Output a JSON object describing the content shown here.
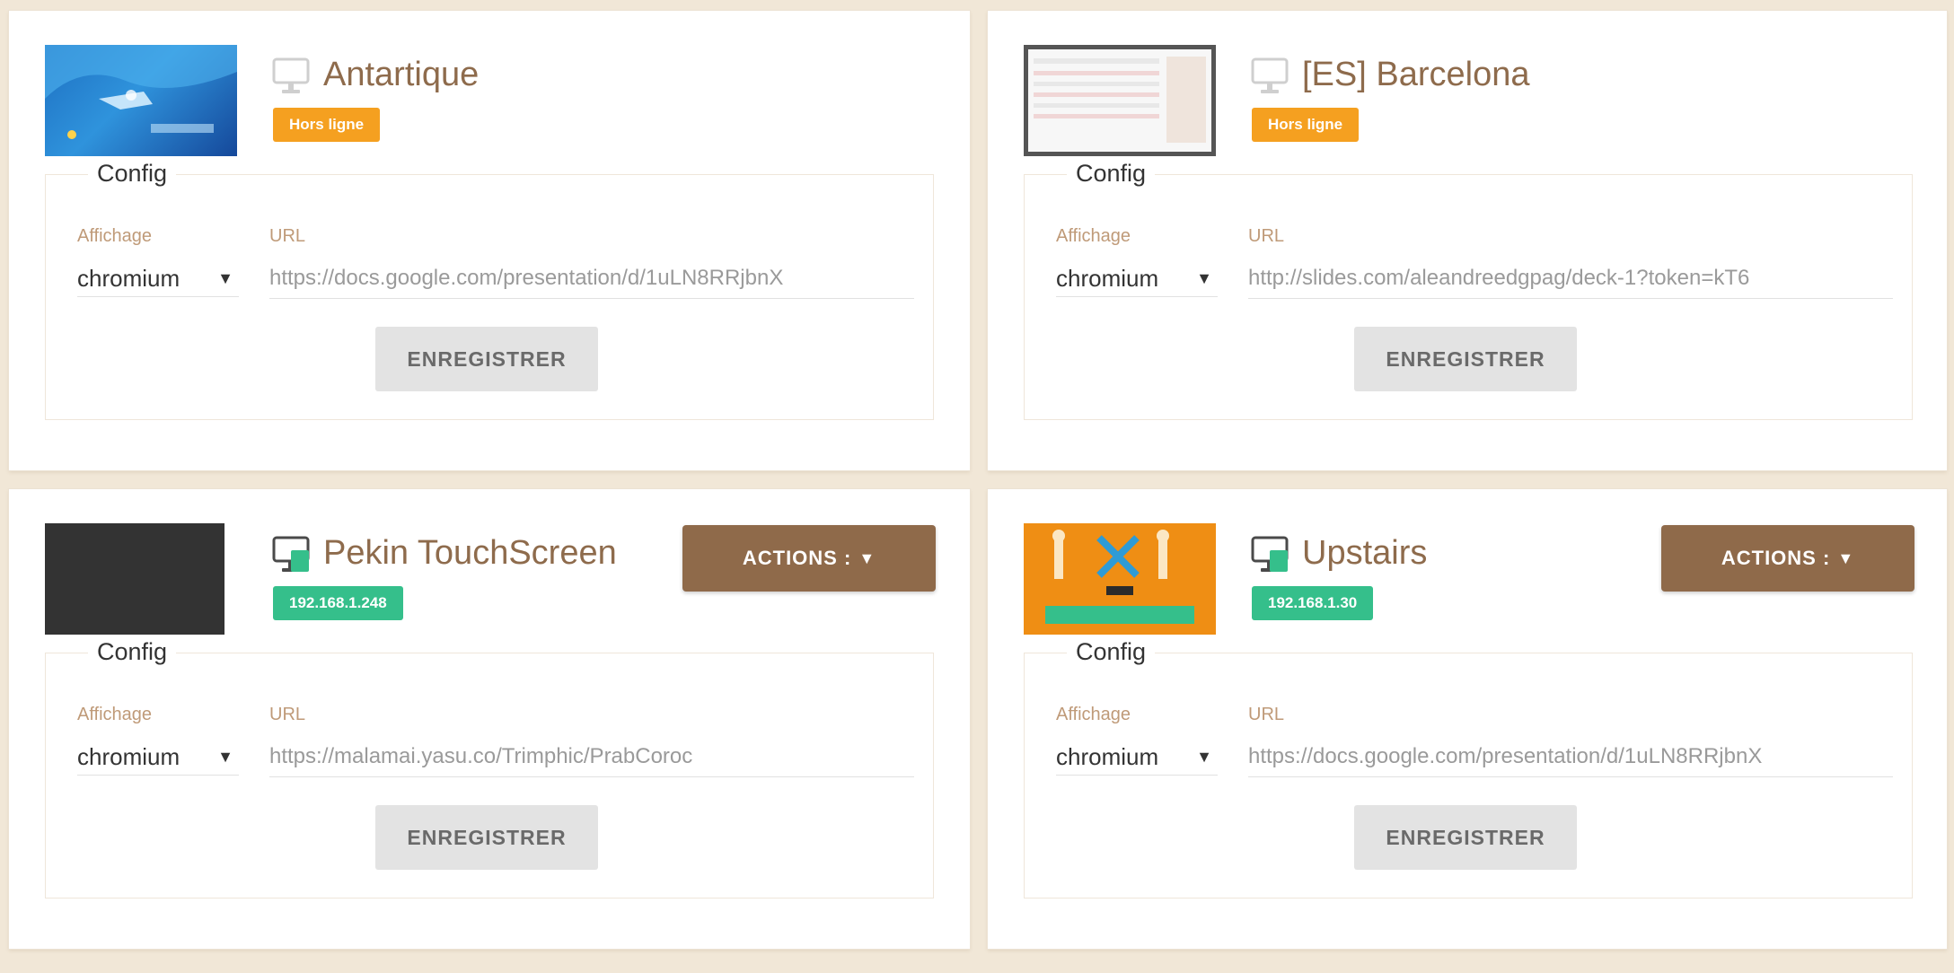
{
  "devices": [
    {
      "name": "Antartique",
      "status_badge": "Hors ligne",
      "config_legend": "Config",
      "affichage_label": "Affichage",
      "url_label": "URL",
      "affichage_value": "chromium",
      "url_value": "https://docs.google.com/presentation/d/1uLN8RRjbnX",
      "save_label": "ENREGISTRER"
    },
    {
      "name": "[ES] Barcelona",
      "status_badge": "Hors ligne",
      "config_legend": "Config",
      "affichage_label": "Affichage",
      "url_label": "URL",
      "affichage_value": "chromium",
      "url_value": "http://slides.com/aleandreedgpag/deck-1?token=kT6",
      "save_label": "ENREGISTRER"
    },
    {
      "name": "Pekin TouchScreen",
      "status_badge": "192.168.1.248",
      "actions_label": "ACTIONS :",
      "config_legend": "Config",
      "affichage_label": "Affichage",
      "url_label": "URL",
      "affichage_value": "chromium",
      "url_value": "https://malamai.yasu.co/Trimphic/PrabCoroc",
      "save_label": "ENREGISTRER"
    },
    {
      "name": "Upstairs",
      "status_badge": "192.168.1.30",
      "actions_label": "ACTIONS :",
      "config_legend": "Config",
      "affichage_label": "Affichage",
      "url_label": "URL",
      "affichage_value": "chromium",
      "url_value": "https://docs.google.com/presentation/d/1uLN8RRjbnX",
      "save_label": "ENREGISTRER"
    }
  ],
  "icons": {
    "offline": "monitor-icon",
    "online": "monitor-online-icon",
    "dropdown": "caret-down-icon"
  },
  "colors": {
    "page_background": "#f1e7d7",
    "device_name": "#8e6b4c",
    "offline_badge": "#f5a020",
    "online_badge": "#35bf8b",
    "actions_button": "#8f6a4a",
    "save_button": "#e3e3e3",
    "field_label": "#bf9a78"
  }
}
